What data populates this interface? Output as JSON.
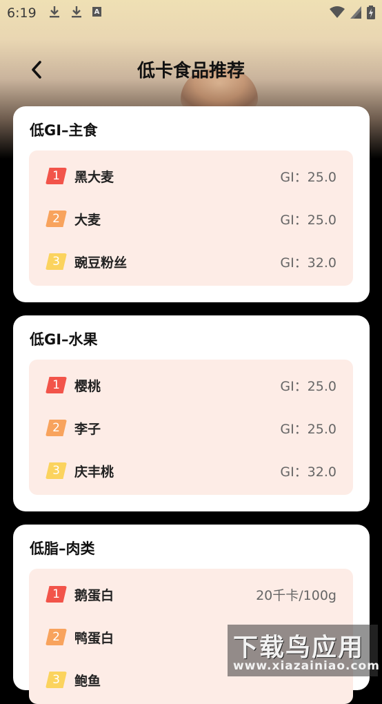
{
  "status_bar": {
    "time": "6:19",
    "left_icons": [
      "download-icon",
      "download-icon",
      "a-notification-icon"
    ],
    "right_icons": [
      "wifi-icon",
      "signal-icon",
      "battery-charging-icon"
    ]
  },
  "header": {
    "title": "低卡食品推荐",
    "back_icon": "chevron-left-icon"
  },
  "colors": {
    "rank1": "#f2544a",
    "rank2": "#f8a35d",
    "rank3": "#fbd35e",
    "list_bg": "#fdece6",
    "card_bg": "#ffffff"
  },
  "cards": [
    {
      "title": "低GI–主食",
      "items": [
        {
          "rank": "1",
          "name": "黑大麦",
          "value": "GI：25.0"
        },
        {
          "rank": "2",
          "name": "大麦",
          "value": "GI：25.0"
        },
        {
          "rank": "3",
          "name": "豌豆粉丝",
          "value": "GI：32.0"
        }
      ]
    },
    {
      "title": "低GI–水果",
      "items": [
        {
          "rank": "1",
          "name": "樱桃",
          "value": "GI：25.0"
        },
        {
          "rank": "2",
          "name": "李子",
          "value": "GI：25.0"
        },
        {
          "rank": "3",
          "name": "庆丰桃",
          "value": "GI：32.0"
        }
      ]
    },
    {
      "title": "低脂–肉类",
      "items": [
        {
          "rank": "1",
          "name": "鹅蛋白",
          "value": "20千卡/100g"
        },
        {
          "rank": "2",
          "name": "鸭蛋白",
          "value": ""
        },
        {
          "rank": "3",
          "name": "鲍鱼",
          "value": ""
        }
      ]
    }
  ],
  "watermark": {
    "main": "下载鸟应用",
    "sub": "www.xiazainiao.com"
  }
}
